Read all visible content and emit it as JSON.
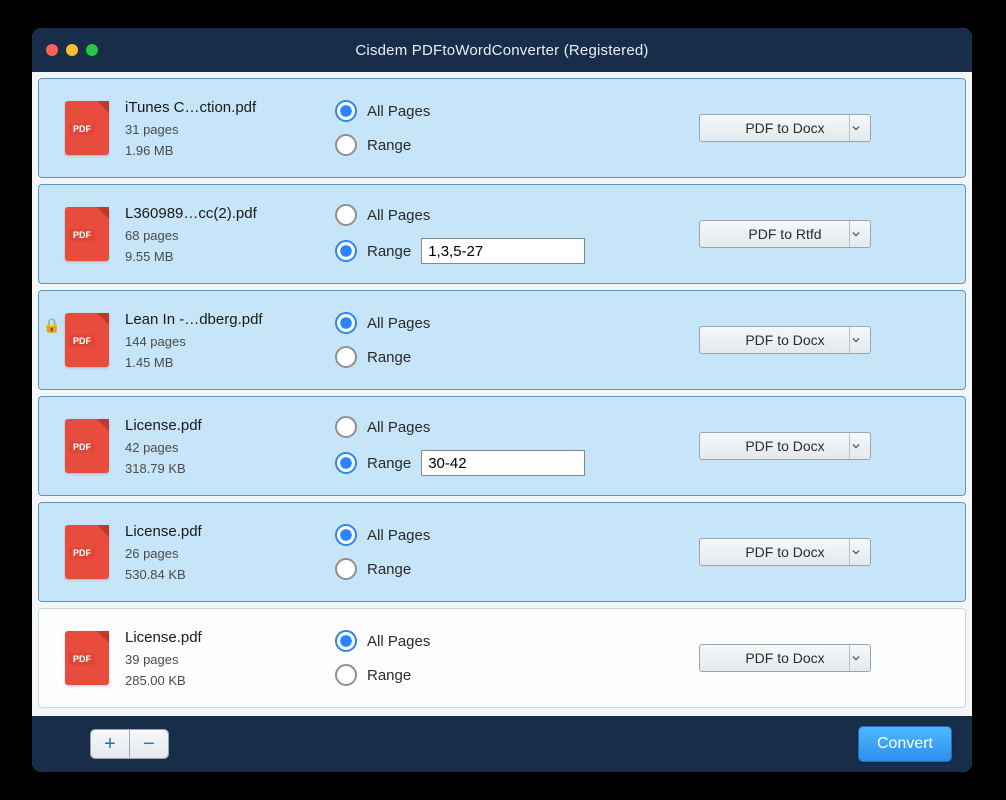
{
  "window": {
    "title": "Cisdem PDFtoWordConverter (Registered)"
  },
  "labels": {
    "all_pages": "All Pages",
    "range": "Range"
  },
  "footer": {
    "convert_label": "Convert"
  },
  "files": [
    {
      "name": "iTunes C…ction.pdf",
      "pages": "31 pages",
      "size": "1.96 MB",
      "selected": true,
      "locked": false,
      "option": "all",
      "range_value": "",
      "format": "PDF to Docx"
    },
    {
      "name": "L360989…cc(2).pdf",
      "pages": "68 pages",
      "size": "9.55 MB",
      "selected": true,
      "locked": false,
      "option": "range",
      "range_value": "1,3,5-27",
      "format": "PDF to Rtfd"
    },
    {
      "name": "Lean In -…dberg.pdf",
      "pages": "144 pages",
      "size": "1.45 MB",
      "selected": true,
      "locked": true,
      "option": "all",
      "range_value": "",
      "format": "PDF to Docx"
    },
    {
      "name": "License.pdf",
      "pages": "42 pages",
      "size": "318.79 KB",
      "selected": true,
      "locked": false,
      "option": "range",
      "range_value": "30-42",
      "format": "PDF to Docx"
    },
    {
      "name": "License.pdf",
      "pages": "26 pages",
      "size": "530.84 KB",
      "selected": true,
      "locked": false,
      "option": "all",
      "range_value": "",
      "format": "PDF to Docx"
    },
    {
      "name": "License.pdf",
      "pages": "39 pages",
      "size": "285.00 KB",
      "selected": false,
      "locked": false,
      "option": "all",
      "range_value": "",
      "format": "PDF to Docx"
    }
  ]
}
